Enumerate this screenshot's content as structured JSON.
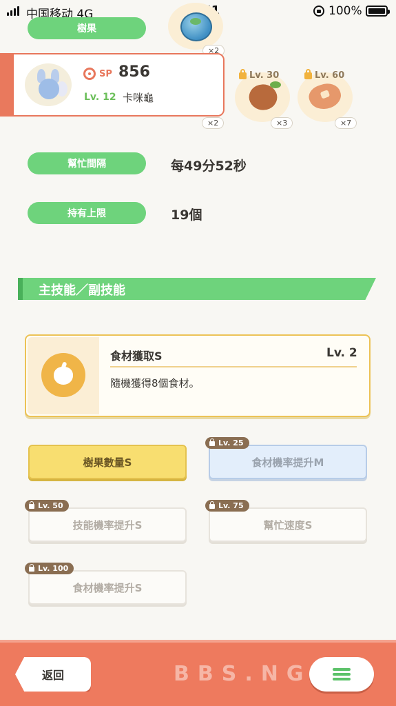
{
  "status_bar": {
    "carrier": "中国移动  4G",
    "time": "07:51",
    "battery": "100%"
  },
  "berry": {
    "label": "樹果",
    "count_top": "×2",
    "count_bottom": "×2"
  },
  "pokemon": {
    "sp_label": "SP",
    "sp_value": "856",
    "level": "Lv. 12",
    "name": "卡咪龜"
  },
  "ingredients": [
    {
      "lock_level": "Lv. 30",
      "count": "×3",
      "icon": "cacao-icon"
    },
    {
      "lock_level": "Lv. 60",
      "count": "×7",
      "icon": "potato-icon"
    }
  ],
  "info": {
    "help_interval_label": "幫忙間隔",
    "help_interval_value": "每49分52秒",
    "capacity_label": "持有上限",
    "capacity_value": "19個"
  },
  "skills_section": {
    "title": "主技能／副技能"
  },
  "main_skill": {
    "name": "食材獲取S",
    "level": "Lv. 2",
    "description": "隨機獲得8個食材。",
    "icon": "apple-icon"
  },
  "sub_skills": [
    {
      "label": "樹果數量S",
      "lock_level": "",
      "state": "active"
    },
    {
      "label": "食材機率提升M",
      "lock_level": "Lv. 25",
      "state": "locked"
    },
    {
      "label": "技能機率提升S",
      "lock_level": "Lv. 50",
      "state": "locked"
    },
    {
      "label": "幫忙速度S",
      "lock_level": "Lv. 75",
      "state": "locked"
    },
    {
      "label": "食材機率提升S",
      "lock_level": "Lv. 100",
      "state": "locked"
    }
  ],
  "bottom_bar": {
    "back_label": "返回",
    "watermark": "BBS.NGA"
  },
  "colors": {
    "green": "#6ed37c",
    "coral": "#ee7a5e",
    "gold": "#ecc255"
  }
}
